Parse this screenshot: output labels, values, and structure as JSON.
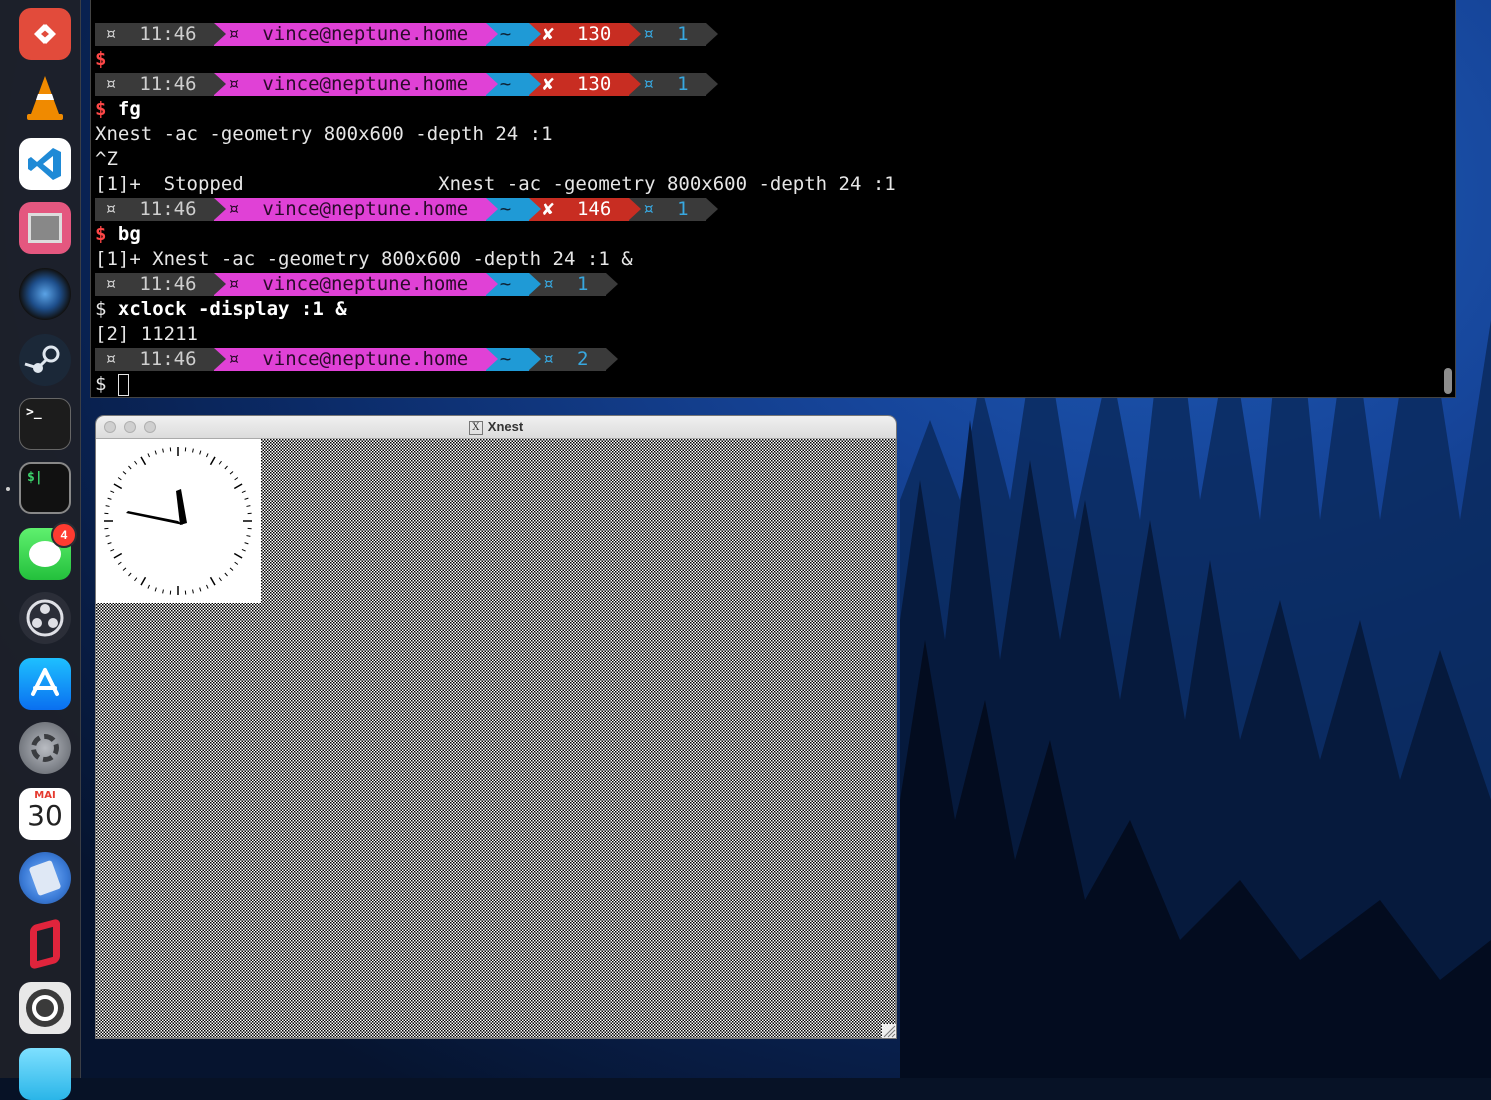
{
  "dock": {
    "items": [
      {
        "name": "remote-desktop-icon",
        "label": ""
      },
      {
        "name": "vlc-icon",
        "label": ""
      },
      {
        "name": "vscode-icon",
        "label": ""
      },
      {
        "name": "emulator-icon",
        "label": ""
      },
      {
        "name": "camera-lens-icon",
        "label": ""
      },
      {
        "name": "steam-icon",
        "label": ""
      },
      {
        "name": "terminal-icon",
        "label": ">_"
      },
      {
        "name": "iterm-icon",
        "label": "$|"
      },
      {
        "name": "messages-icon",
        "label": "",
        "badge": "4"
      },
      {
        "name": "obs-icon",
        "label": ""
      },
      {
        "name": "app-store-icon",
        "label": ""
      },
      {
        "name": "system-settings-icon",
        "label": ""
      },
      {
        "name": "calendar-icon",
        "month": "MAI",
        "day": "30"
      },
      {
        "name": "calculator-icon",
        "label": ""
      },
      {
        "name": "parallels-icon",
        "label": ""
      },
      {
        "name": "aperture-icon",
        "label": ""
      },
      {
        "name": "game-icon",
        "label": ""
      }
    ]
  },
  "terminal": {
    "prompts": [
      {
        "time": "11:46",
        "host": "vince@neptune.home",
        "dir": "~",
        "err": "130",
        "jobs": "1"
      },
      {
        "time": "11:46",
        "host": "vince@neptune.home",
        "dir": "~",
        "err": "130",
        "jobs": "1"
      },
      {
        "time": "11:46",
        "host": "vince@neptune.home",
        "dir": "~",
        "err": "146",
        "jobs": "1"
      },
      {
        "time": "11:46",
        "host": "vince@neptune.home",
        "dir": "~",
        "jobs": "1"
      },
      {
        "time": "11:46",
        "host": "vince@neptune.home",
        "dir": "~",
        "jobs": "2"
      }
    ],
    "glyph": "¤",
    "x_mark": "✘",
    "dollar": "$",
    "cmd_fg": "fg",
    "out_xnest": "Xnest -ac -geometry 800x600 -depth 24 :1",
    "out_ctrlz": "^Z",
    "out_stopped": "[1]+  Stopped                 Xnest -ac -geometry 800x600 -depth 24 :1",
    "cmd_bg": "bg",
    "out_bg": "[1]+ Xnest -ac -geometry 800x600 -depth 24 :1 &",
    "cmd_xclock": "xclock -display :1 &",
    "out_pid": "[2] 11211"
  },
  "xnest": {
    "title": "Xnest",
    "title_icon": "X"
  },
  "colors": {
    "host": "#e041d6",
    "dir": "#1f9ad6",
    "err": "#c82d22",
    "segment": "#3a3a3a"
  }
}
